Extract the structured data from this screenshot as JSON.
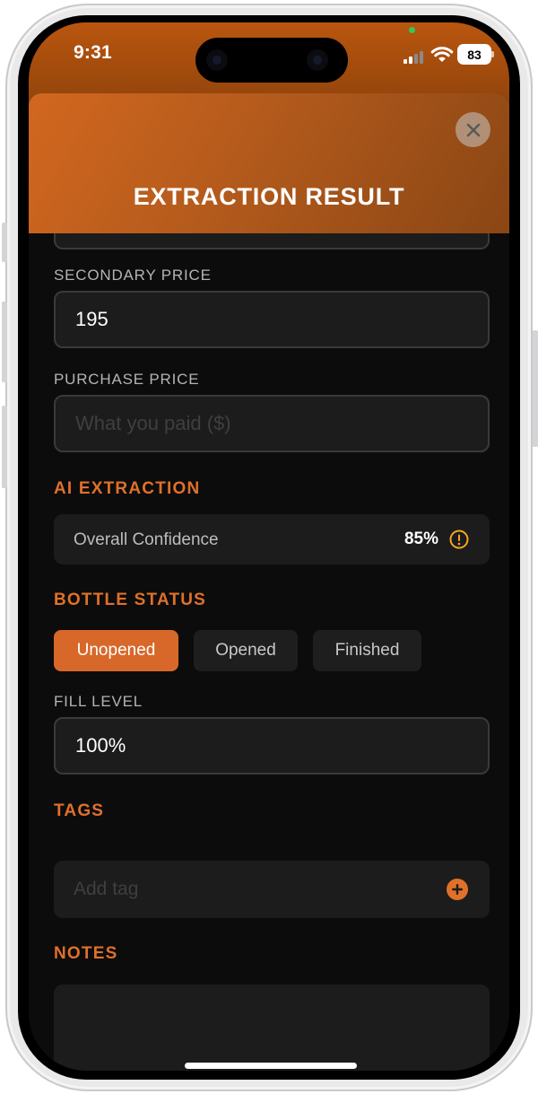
{
  "status_bar": {
    "time": "9:31",
    "battery": "83"
  },
  "sheet": {
    "title": "EXTRACTION RESULT"
  },
  "fields": {
    "secondary_price": {
      "label": "SECONDARY PRICE",
      "value": "195"
    },
    "purchase_price": {
      "label": "PURCHASE PRICE",
      "placeholder": "What you paid ($)"
    },
    "fill_level": {
      "label": "FILL LEVEL",
      "value": "100%"
    }
  },
  "ai_extraction": {
    "title": "AI EXTRACTION",
    "confidence_label": "Overall Confidence",
    "confidence_value": "85%"
  },
  "bottle_status": {
    "title": "BOTTLE STATUS",
    "options": [
      "Unopened",
      "Opened",
      "Finished"
    ],
    "selected": "Unopened"
  },
  "tags": {
    "title": "TAGS",
    "placeholder": "Add tag"
  },
  "notes": {
    "title": "NOTES"
  },
  "colors": {
    "accent": "#e0702a",
    "header_gradient_start": "#d2671f",
    "header_gradient_end": "#8a4614",
    "background": "#0c0c0c",
    "field_bg": "#1c1c1c",
    "warning": "#f5a623"
  }
}
